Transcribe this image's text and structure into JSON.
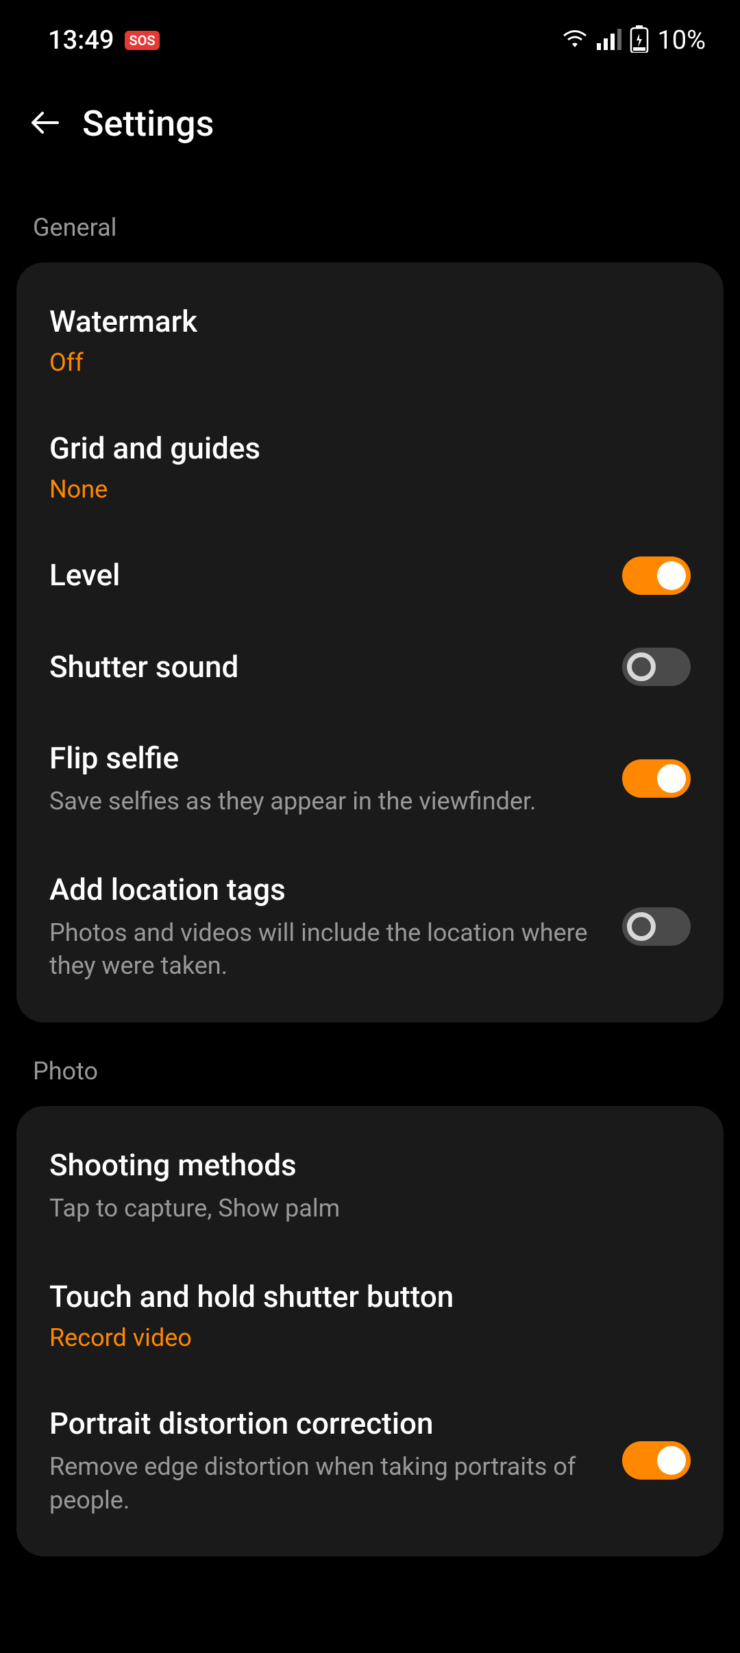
{
  "statusBar": {
    "time": "13:49",
    "sosLabel": "SOS",
    "batteryPercent": "10%"
  },
  "header": {
    "title": "Settings"
  },
  "sections": {
    "general": {
      "label": "General",
      "watermark": {
        "title": "Watermark",
        "value": "Off"
      },
      "gridGuides": {
        "title": "Grid and guides",
        "value": "None"
      },
      "level": {
        "title": "Level",
        "toggle": true
      },
      "shutterSound": {
        "title": "Shutter sound",
        "toggle": false
      },
      "flipSelfie": {
        "title": "Flip selfie",
        "desc": "Save selfies as they appear in the viewfinder.",
        "toggle": true
      },
      "locationTags": {
        "title": "Add location tags",
        "desc": "Photos and videos will include the location where they were taken.",
        "toggle": false
      }
    },
    "photo": {
      "label": "Photo",
      "shootingMethods": {
        "title": "Shooting methods",
        "desc": "Tap to capture, Show palm"
      },
      "touchHold": {
        "title": "Touch and hold shutter button",
        "value": "Record video"
      },
      "portraitDistortion": {
        "title": "Portrait distortion correction",
        "desc": "Remove edge distortion when taking portraits of people.",
        "toggle": true
      }
    }
  }
}
